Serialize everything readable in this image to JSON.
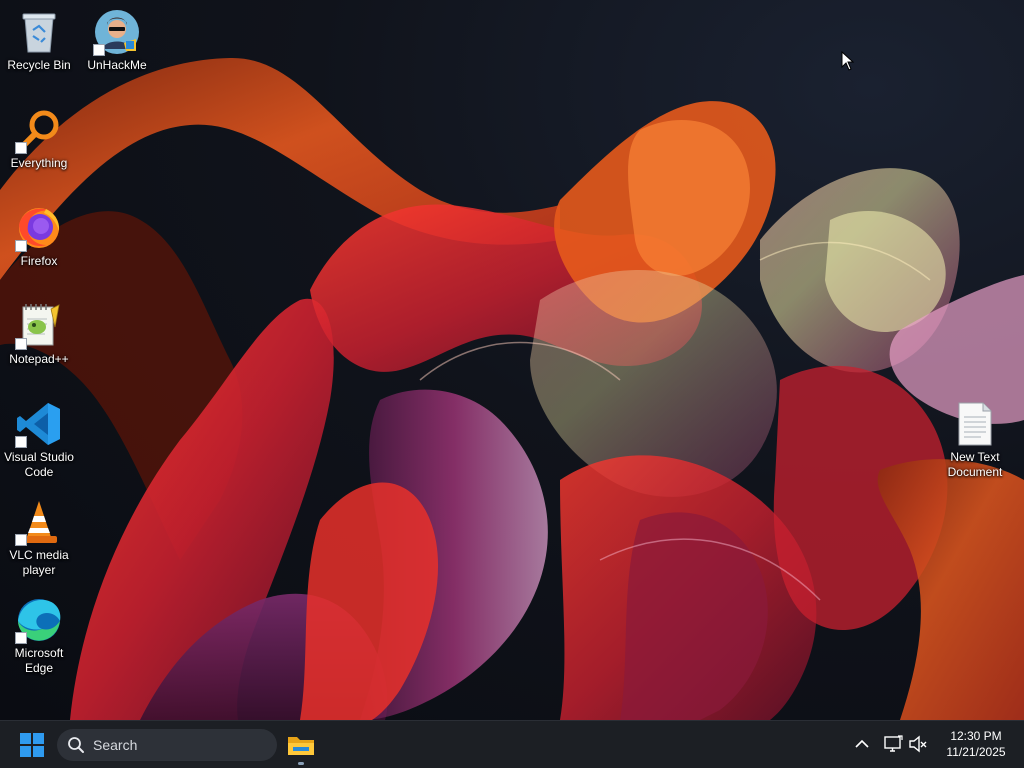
{
  "desktop": {
    "icons": [
      {
        "label": "Recycle Bin",
        "icon": "recycle-bin-icon"
      },
      {
        "label": "UnHackMe",
        "icon": "unhackme-icon"
      },
      {
        "label": "Everything",
        "icon": "everything-search-icon"
      },
      {
        "label": "Firefox",
        "icon": "firefox-icon"
      },
      {
        "label": "Notepad++",
        "icon": "notepad-plus-plus-icon"
      },
      {
        "label": "Visual Studio Code",
        "icon": "vscode-icon"
      },
      {
        "label": "VLC media player",
        "icon": "vlc-icon"
      },
      {
        "label": "Microsoft Edge",
        "icon": "edge-icon"
      },
      {
        "label": "New Text Document",
        "icon": "text-document-icon"
      }
    ]
  },
  "taskbar": {
    "search_placeholder": "Search",
    "pinned": [
      {
        "name": "File Explorer",
        "icon": "file-explorer-icon",
        "active": true
      }
    ],
    "tray": {
      "overflow_icon": "chevron-up-icon",
      "network_icon": "network-icon",
      "volume_icon": "volume-muted-icon"
    },
    "clock": {
      "time": "12:30 PM",
      "date": "11/21/2025"
    }
  },
  "colors": {
    "taskbar_bg": "#1c1f24",
    "search_bg": "#2d3138",
    "start_blue": "#2f9bf0",
    "ribbon_orange": "#e0561e",
    "ribbon_red": "#c8202f",
    "ribbon_magenta": "#b63a86"
  }
}
